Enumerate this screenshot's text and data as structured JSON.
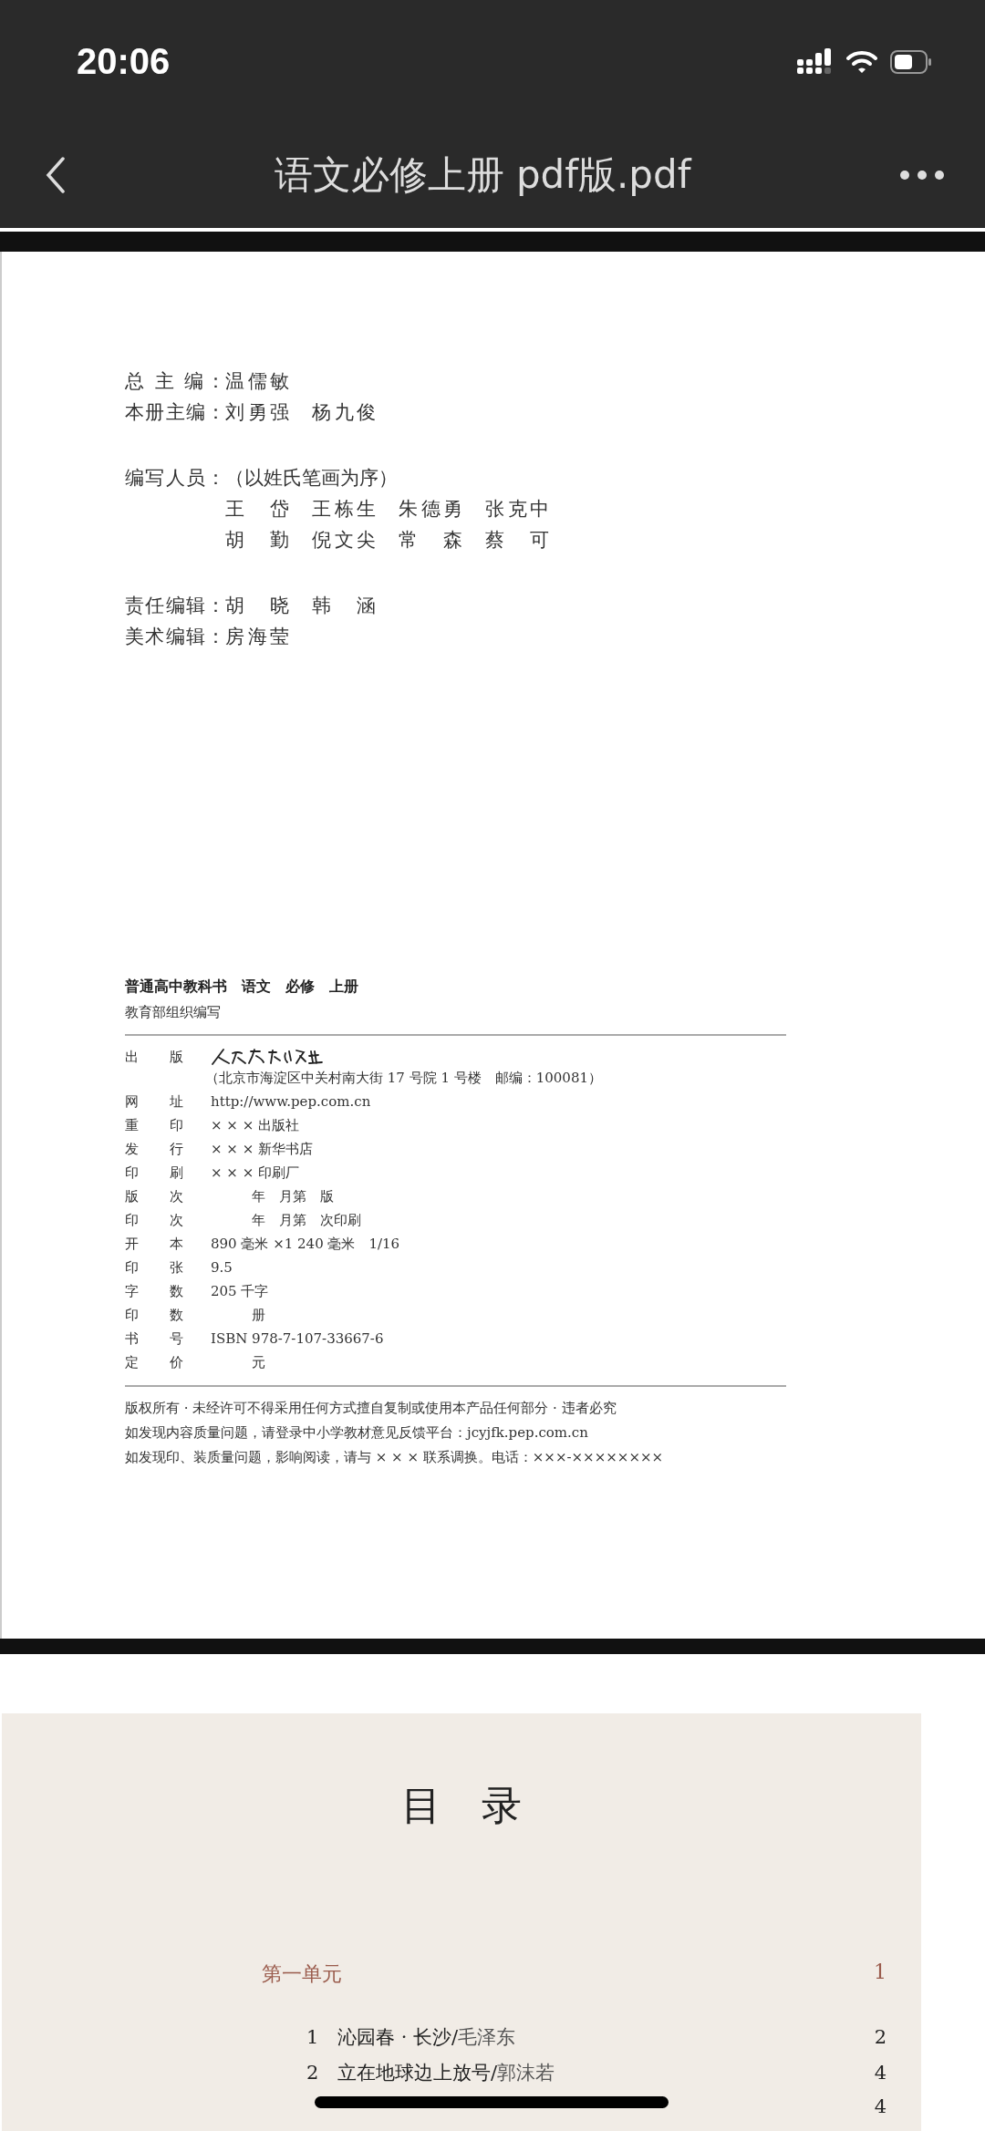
{
  "status_bar": {
    "time": "20:06"
  },
  "nav_bar": {
    "title": "语文必修上册 pdf版.pdf"
  },
  "credits": [
    {
      "label": "总 主 编：",
      "names": [
        "温儒敏"
      ]
    },
    {
      "label": "本册主编：",
      "names": [
        "刘勇强",
        "杨九俊"
      ]
    },
    {
      "label": "编写人员：",
      "note": "（以姓氏笔画为序）",
      "names": [
        "王 岱",
        "王栋生",
        "朱德勇",
        "张克中",
        "胡 勤",
        "倪文尖",
        "常 森",
        "蔡 可"
      ]
    },
    {
      "label": "责任编辑：",
      "names": [
        "胡 晓",
        "韩 涵"
      ]
    },
    {
      "label": "美术编辑：",
      "names": [
        "房海莹"
      ]
    }
  ],
  "colophon": {
    "title": "普通高中教科书　语文　必修　上册",
    "subtitle": "教育部组织编写",
    "rows": [
      {
        "label": "出 版",
        "kind": "logo",
        "note": "（北京市海淀区中关村南大街 17 号院 1 号楼　邮编：100081）"
      },
      {
        "label": "网 址",
        "kind": "text",
        "value": "http://www.pep.com.cn"
      },
      {
        "label": "重 印",
        "kind": "text",
        "value": "× × × 出版社"
      },
      {
        "label": "发 行",
        "kind": "text",
        "value": "× × × 新华书店"
      },
      {
        "label": "印 刷",
        "kind": "text",
        "value": "× × × 印刷厂"
      },
      {
        "label": "版 次",
        "kind": "text",
        "value": "　　　年　月第　版"
      },
      {
        "label": "印 次",
        "kind": "text",
        "value": "　　　年　月第　次印刷"
      },
      {
        "label": "开 本",
        "kind": "text",
        "value": "890 毫米 ×1 240 毫米　1/16"
      },
      {
        "label": "印 张",
        "kind": "text",
        "value": "9.5"
      },
      {
        "label": "字 数",
        "kind": "text",
        "value": "205 千字"
      },
      {
        "label": "印 数",
        "kind": "text",
        "value": "　　　册"
      },
      {
        "label": "书 号",
        "kind": "text",
        "value": "ISBN 978-7-107-33667-6"
      },
      {
        "label": "定 价",
        "kind": "text",
        "value": "　　　元"
      }
    ],
    "notices": [
      "版权所有 · 未经许可不得采用任何方式擅自复制或使用本产品任何部分 · 违者必究",
      "如发现内容质量问题，请登录中小学教材意见反馈平台：jcyjfk.pep.com.cn",
      "如发现印、装质量问题，影响阅读，请与 × × × 联系调换。电话：×××-××××××××"
    ]
  },
  "toc": {
    "title": "目　录",
    "units": [
      {
        "title": "第一单元",
        "page": "1",
        "items": [
          {
            "number": "1",
            "title": "沁园春 · 长沙/",
            "author": "毛泽东",
            "page": "2"
          },
          {
            "number": "2",
            "title": "立在地球边上放号/",
            "author": "郭沫若",
            "page": "4"
          },
          {
            "page": "4"
          }
        ]
      }
    ]
  }
}
